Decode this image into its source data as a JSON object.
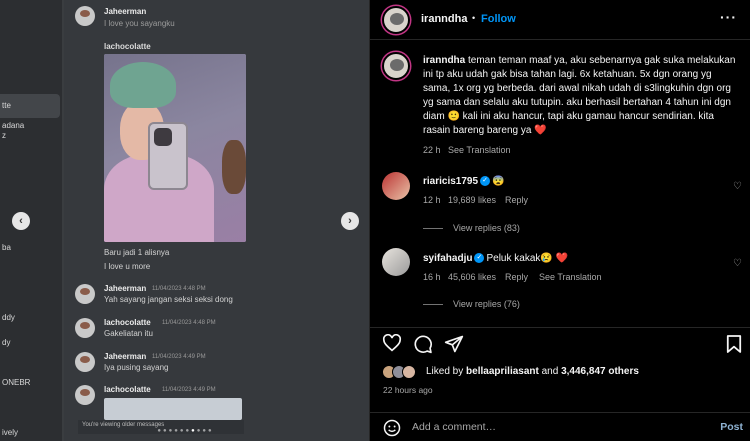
{
  "media": {
    "sidebar_items": [
      "tte",
      "adana",
      "z",
      "ba",
      "ddy",
      "dy",
      "ONEBR",
      "ively"
    ],
    "prev_arrow": "‹",
    "next_arrow": "›",
    "messages": [
      {
        "user": "Jaheerman",
        "time": "",
        "text": "I love you sayangku"
      },
      {
        "user": "lachocolatte",
        "time": "",
        "text": ""
      },
      {
        "user": "",
        "time": "",
        "text": "Baru jadi 1 alisnya"
      },
      {
        "user": "",
        "time": "",
        "text": "I love u more"
      },
      {
        "user": "Jaheerman",
        "time": "11/04/2023 4:48 PM",
        "text": "Yah sayang jangan seksi seksi dong"
      },
      {
        "user": "lachocolatte",
        "time": "11/04/2023 4:48 PM",
        "text": "Gakeliatan itu"
      },
      {
        "user": "Jaheerman",
        "time": "11/04/2023 4:49 PM",
        "text": "Iya pusing sayang"
      },
      {
        "user": "lachocolatte",
        "time": "11/04/2023 4:49 PM",
        "text": ""
      }
    ],
    "viewing_older": "You're viewing older messages",
    "carousel_dots": 10,
    "carousel_active": 7
  },
  "post": {
    "username": "iranndha",
    "dot": "•",
    "follow_label": "Follow",
    "more_label": "···",
    "caption": "teman teman maaf ya, aku sebenarnya gak suka melakukan ini tp aku udah gak bisa tahan lagi. 6x ketahuan. 5x dgn orang yg sama, 1x org yg berbeda. dari awal nikah udah di s3lingkuhin dgn org yg sama dan selalu aku tutupin. aku berhasil bertahan 4 tahun ini dgn diam 🙂 kali ini aku hancur, tapi aku gamau hancur sendirian. kita rasain bareng bareng ya ❤️",
    "caption_time": "22 h",
    "see_translation": "See Translation",
    "comments": [
      {
        "user": "riaricis1795",
        "verified": true,
        "text": "😨",
        "time": "12 h",
        "likes": "19,689 likes",
        "reply": "Reply",
        "see_translation": "",
        "view_replies": "View replies (83)"
      },
      {
        "user": "syifahadju",
        "verified": true,
        "text": "Peluk kakak😢 ❤️",
        "time": "16 h",
        "likes": "45,606 likes",
        "reply": "Reply",
        "see_translation": "See Translation",
        "view_replies": "View replies (76)"
      }
    ],
    "liked_by_prefix": "Liked by",
    "liked_by_user": "bellaapriliasant",
    "liked_by_and": "and",
    "liked_by_others": "3,446,847 others",
    "posted_ago": "22 hours ago",
    "comment_placeholder": "Add a comment…",
    "post_label": "Post",
    "accent_color": "#0095f6"
  }
}
